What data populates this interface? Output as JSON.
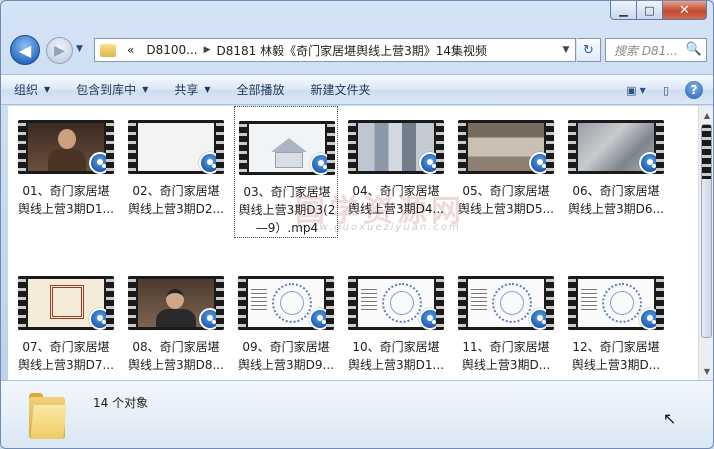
{
  "window": {
    "caption": {
      "minimize": "▁",
      "maximize": "□",
      "close": "✕"
    }
  },
  "nav": {
    "back_icon": "back-arrow-icon",
    "forward_icon": "forward-arrow-icon",
    "history": "▼",
    "address": {
      "overflow": "«",
      "segments": [
        "D8100...",
        "D8181 林毅《奇门家居堪舆线上营3期》14集视频"
      ],
      "separator": "▶",
      "dropdown": "▼"
    },
    "refresh": "↻",
    "search_placeholder": "搜索 D81...",
    "search_icon": "🔍"
  },
  "toolbar": {
    "organize": "组织",
    "include": "包含到库中",
    "share": "共享",
    "play_all": "全部播放",
    "new_folder": "新建文件夹",
    "arrow": "▼",
    "view_icon": "▣",
    "view_arrow": "▼",
    "pane_icon": "▯",
    "help": "?"
  },
  "watermark": {
    "main": "国学资源网",
    "sub": "www.guoxueziyuan.com"
  },
  "files": [
    {
      "line1": "01、奇门家居堪",
      "line2": "舆线上营3期D1...",
      "thumb": "person"
    },
    {
      "line1": "02、奇门家居堪",
      "line2": "舆线上营3期D2...",
      "thumb": "white"
    },
    {
      "line1": "03、奇门家居堪",
      "line2": "舆线上营3期D3(2",
      "line3": "—9）.mp4",
      "thumb": "house",
      "selected": true
    },
    {
      "line1": "04、奇门家居堪",
      "line2": "舆线上营3期D4...",
      "thumb": "city"
    },
    {
      "line1": "05、奇门家居堪",
      "line2": "舆线上营3期D5...",
      "thumb": "room"
    },
    {
      "line1": "06、奇门家居堪",
      "line2": "舆线上营3期D6...",
      "thumb": "aerial"
    },
    {
      "line1": "07、奇门家居堪",
      "line2": "舆线上营3期D7...",
      "thumb": "bagua"
    },
    {
      "line1": "08、奇门家居堪",
      "line2": "舆线上营3期D8...",
      "thumb": "person2"
    },
    {
      "line1": "09、奇门家居堪",
      "line2": "舆线上营3期D9...",
      "thumb": "wheel"
    },
    {
      "line1": "10、奇门家居堪",
      "line2": "舆线上营3期D1...",
      "thumb": "wheel"
    },
    {
      "line1": "11、奇门家居堪",
      "line2": "舆线上营3期D...",
      "thumb": "wheel"
    },
    {
      "line1": "12、奇门家居堪",
      "line2": "舆线上营3期D...",
      "thumb": "wheel"
    }
  ],
  "status": {
    "count": "14 个对象"
  }
}
